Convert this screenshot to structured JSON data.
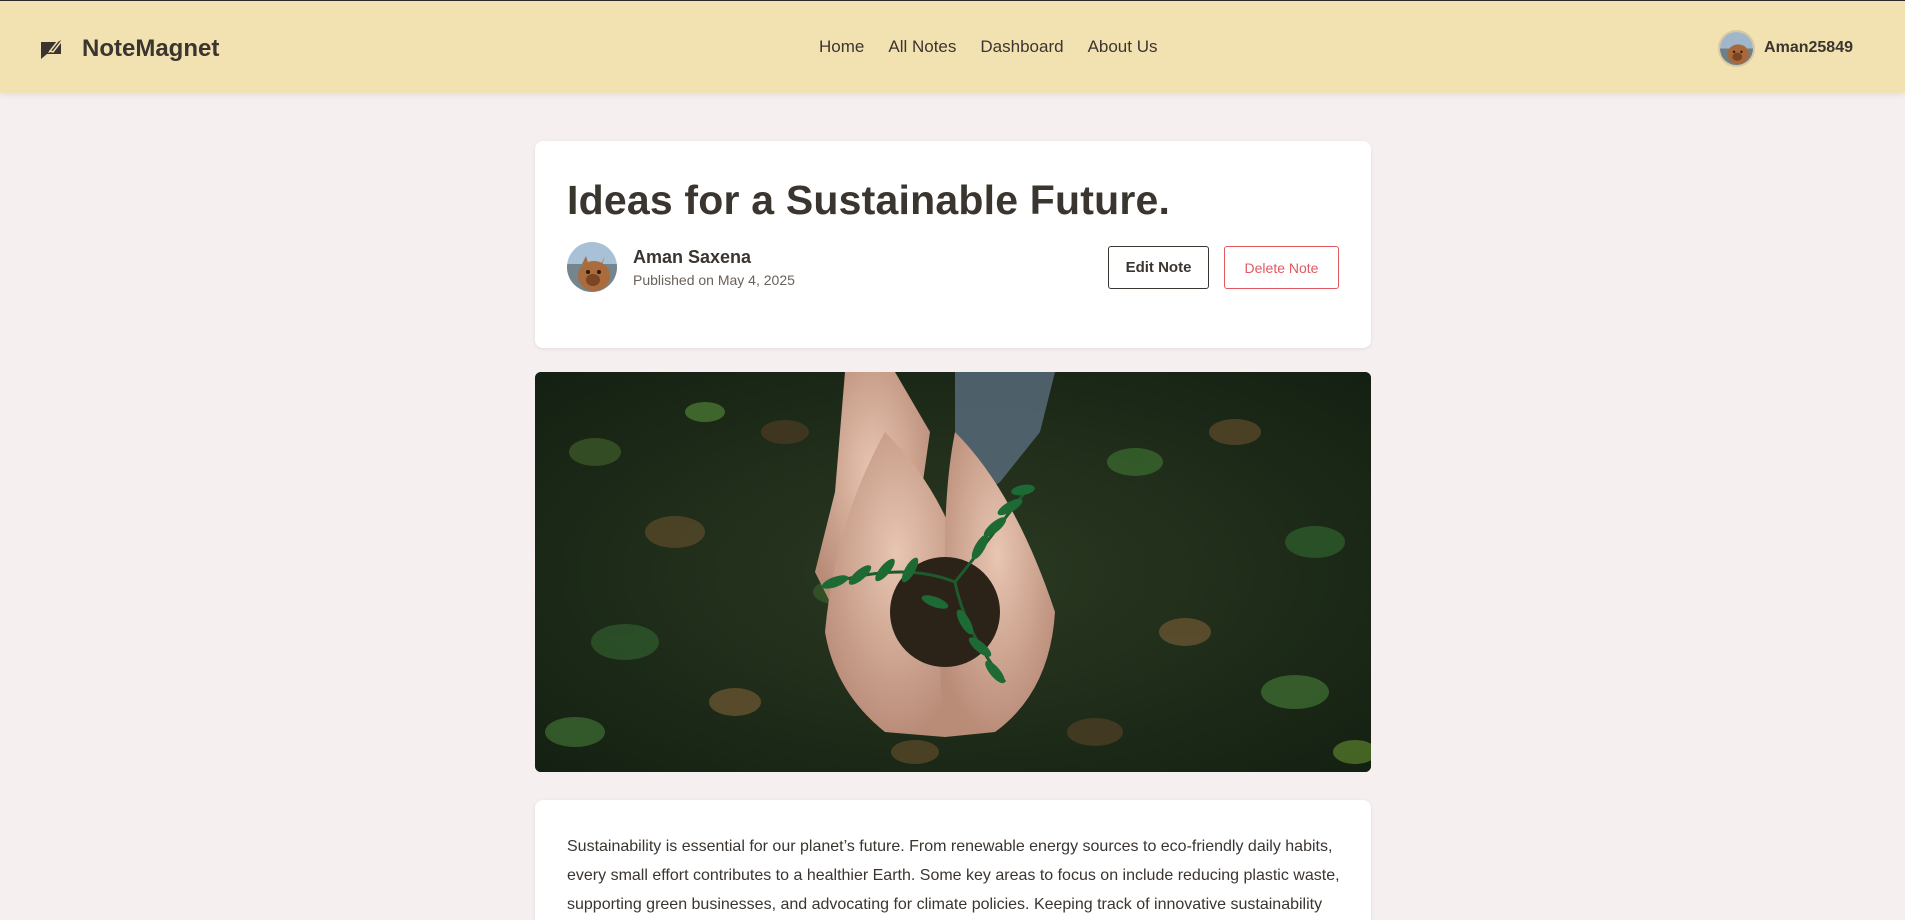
{
  "app": {
    "name": "NoteMagnet",
    "logo_icon": "megaphone-icon"
  },
  "nav": {
    "links": [
      "Home",
      "All Notes",
      "Dashboard",
      "About Us"
    ]
  },
  "user": {
    "username": "Aman25849",
    "avatar_icon": "user-avatar"
  },
  "note": {
    "title": "Ideas for a Sustainable Future.",
    "author": "Aman Saxena",
    "published": "Published on May 4, 2025",
    "edit_label": "Edit Note",
    "delete_label": "Delete Note",
    "image_subject": "hands-holding-plant-image",
    "content": "Sustainability is essential for our planet’s future. From renewable energy sources to eco-friendly daily habits, every small effort contributes to a healthier Earth. Some key areas to focus on include reducing plastic waste, supporting green businesses, and advocating for climate policies. Keeping track of innovative sustainability"
  },
  "colors": {
    "navbar_bg": "#f2e2b2",
    "page_bg": "#f5eff0",
    "text": "#3b3530",
    "danger": "#e05a60"
  }
}
